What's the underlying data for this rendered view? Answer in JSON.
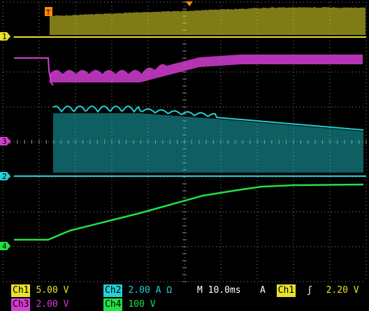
{
  "colors": {
    "ch1": "#e7e22a",
    "ch2": "#22d0d6",
    "ch3": "#d43cd2",
    "ch4": "#22e045",
    "grid": "#8a8a8a",
    "trigger": "#ff8a00"
  },
  "markers": {
    "trigger_position_label": "T",
    "trigger_level_icon": "triangle-down-orange",
    "ch1": "1",
    "ch2": "2",
    "ch3": "3",
    "ch4": "4"
  },
  "status": {
    "ch1": {
      "name": "Ch1",
      "scale": "5.00 V"
    },
    "ch2": {
      "name": "Ch2",
      "scale": "2.00 A Ω"
    },
    "ch3": {
      "name": "Ch3",
      "scale": "2.00 V"
    },
    "ch4": {
      "name": "Ch4",
      "scale": "100 V"
    },
    "timebase": "M 10.0ms",
    "trigger": {
      "mode": "A",
      "source": "Ch1",
      "slope": "ʃ",
      "level": "2.20 V"
    }
  }
}
